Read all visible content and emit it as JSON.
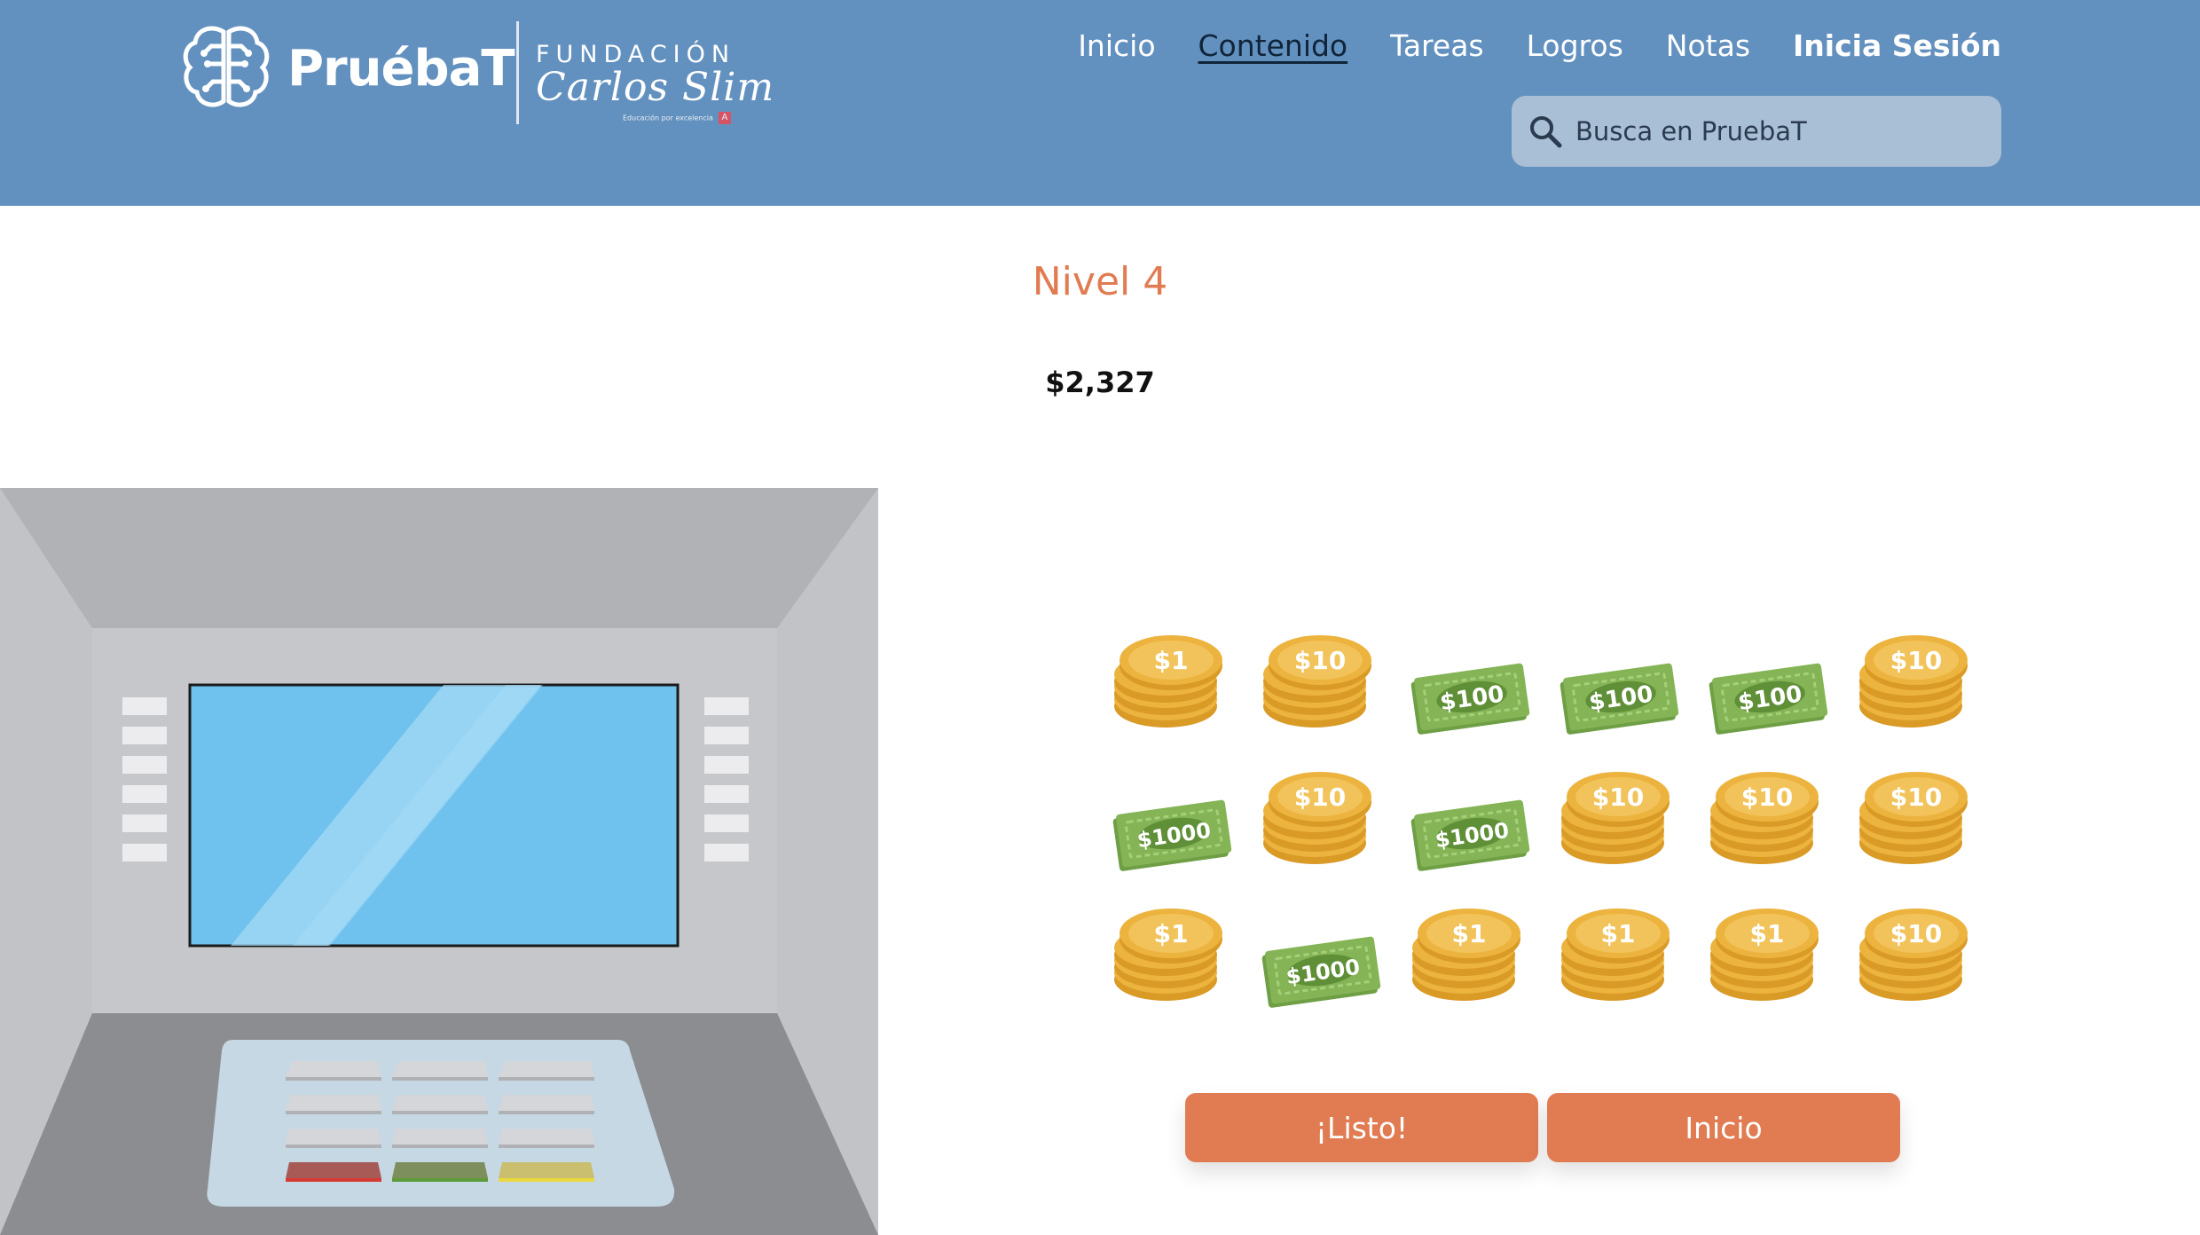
{
  "header": {
    "brand": "PruébaT",
    "foundation_top": "FUNDACIÓN",
    "foundation_script": "Carlos Slim",
    "foundation_small": "Educación por excelencia",
    "nav": [
      {
        "label": "Inicio",
        "active": false
      },
      {
        "label": "Contenido",
        "active": true
      },
      {
        "label": "Tareas",
        "active": false
      },
      {
        "label": "Logros",
        "active": false
      },
      {
        "label": "Notas",
        "active": false
      },
      {
        "label": "Inicia Sesión",
        "active": false
      }
    ],
    "search_placeholder": "Busca en PruebaT"
  },
  "game": {
    "level_title": "Nivel 4",
    "target_amount": "$2,327",
    "money_items": [
      {
        "type": "coin",
        "label": "$1"
      },
      {
        "type": "coin",
        "label": "$10"
      },
      {
        "type": "bill",
        "label": "$100"
      },
      {
        "type": "bill",
        "label": "$100"
      },
      {
        "type": "bill",
        "label": "$100"
      },
      {
        "type": "coin",
        "label": "$10"
      },
      {
        "type": "bill",
        "label": "$1000"
      },
      {
        "type": "coin",
        "label": "$10"
      },
      {
        "type": "bill",
        "label": "$1000"
      },
      {
        "type": "coin",
        "label": "$10"
      },
      {
        "type": "coin",
        "label": "$10"
      },
      {
        "type": "coin",
        "label": "$10"
      },
      {
        "type": "coin",
        "label": "$1"
      },
      {
        "type": "bill",
        "label": "$1000"
      },
      {
        "type": "coin",
        "label": "$1"
      },
      {
        "type": "coin",
        "label": "$1"
      },
      {
        "type": "coin",
        "label": "$1"
      },
      {
        "type": "coin",
        "label": "$10"
      }
    ],
    "buttons": {
      "done": "¡Listo!",
      "home": "Inicio"
    }
  },
  "colors": {
    "header_bg": "#6391bf",
    "accent": "#e17b52",
    "coin": "#ecb33e",
    "bill": "#84b455"
  }
}
